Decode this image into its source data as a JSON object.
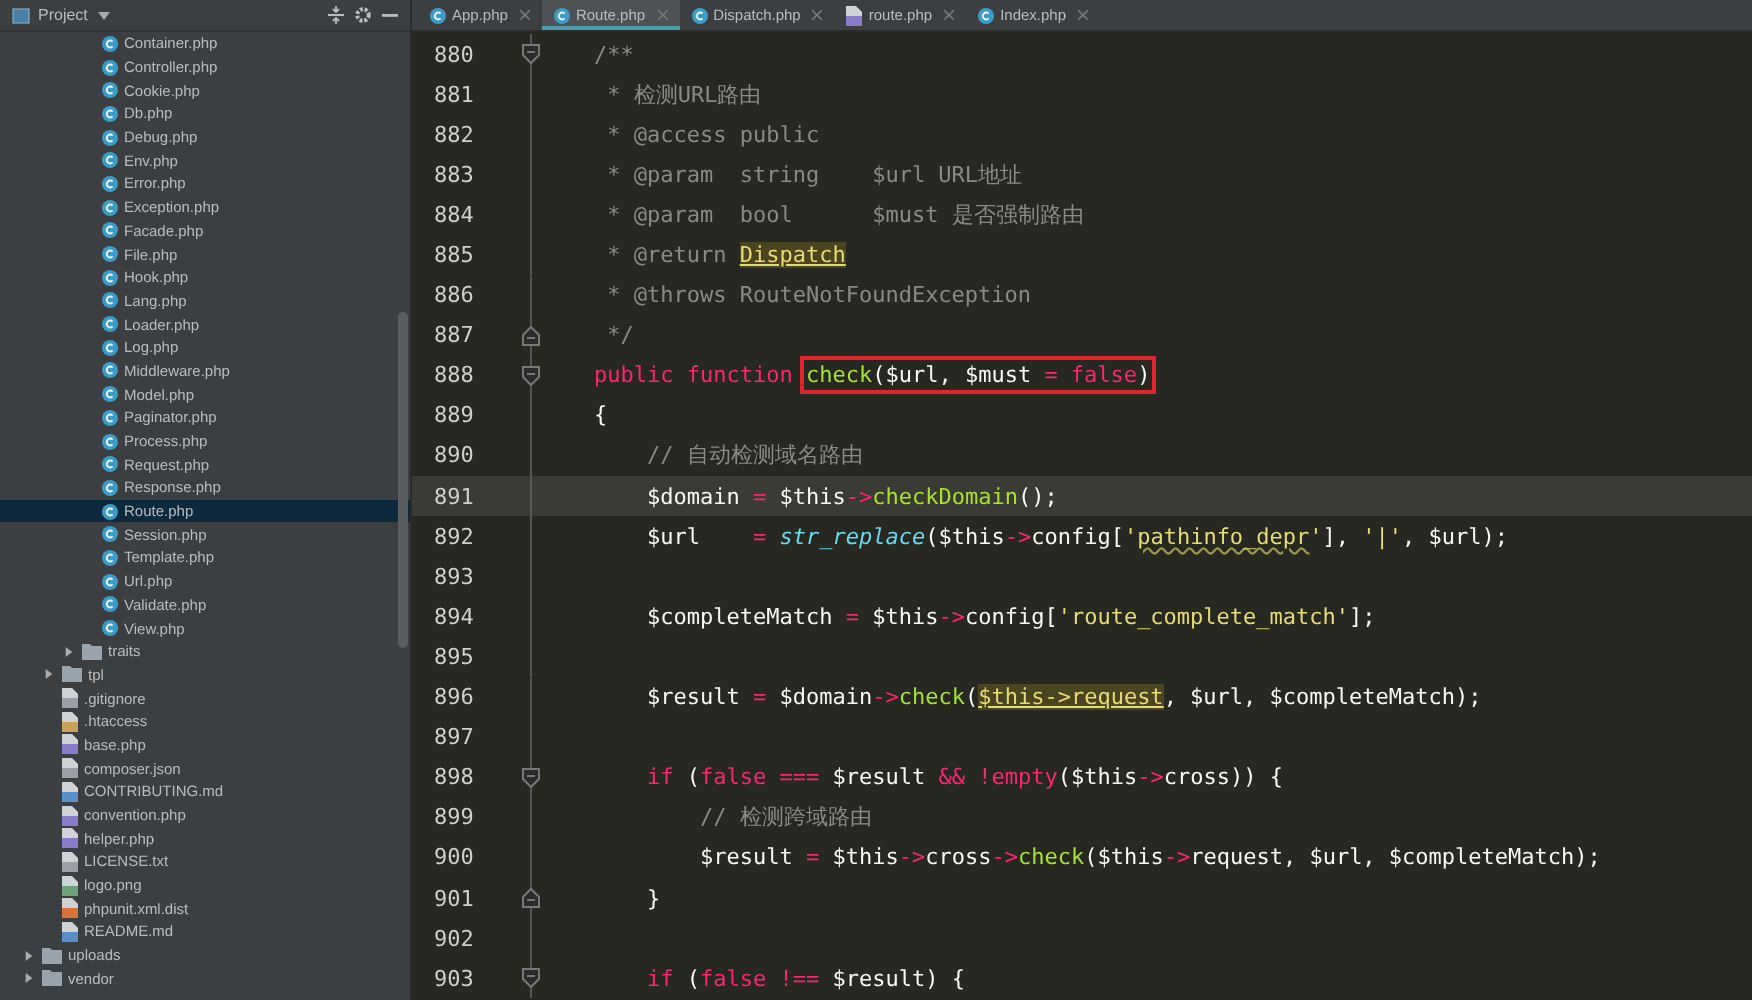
{
  "sidebar": {
    "title": "Project",
    "tree": [
      {
        "children": [
          {
            "children": [
              {
                "children": [
                  {
                    "label": "Container.php",
                    "kind": "class",
                    "selected": false
                  },
                  {
                    "label": "Controller.php",
                    "kind": "class",
                    "selected": false
                  },
                  {
                    "label": "Cookie.php",
                    "kind": "class",
                    "selected": false
                  },
                  {
                    "label": "Db.php",
                    "kind": "class",
                    "selected": false
                  },
                  {
                    "label": "Debug.php",
                    "kind": "class",
                    "selected": false
                  },
                  {
                    "label": "Env.php",
                    "kind": "class",
                    "selected": false
                  },
                  {
                    "label": "Error.php",
                    "kind": "class",
                    "selected": false
                  },
                  {
                    "label": "Exception.php",
                    "kind": "class",
                    "selected": false
                  },
                  {
                    "label": "Facade.php",
                    "kind": "class",
                    "selected": false
                  },
                  {
                    "label": "File.php",
                    "kind": "class",
                    "selected": false
                  },
                  {
                    "label": "Hook.php",
                    "kind": "class",
                    "selected": false
                  },
                  {
                    "label": "Lang.php",
                    "kind": "class",
                    "selected": false
                  },
                  {
                    "label": "Loader.php",
                    "kind": "class",
                    "selected": false
                  },
                  {
                    "label": "Log.php",
                    "kind": "class",
                    "selected": false
                  },
                  {
                    "label": "Middleware.php",
                    "kind": "class",
                    "selected": false
                  },
                  {
                    "label": "Model.php",
                    "kind": "class",
                    "selected": false
                  },
                  {
                    "label": "Paginator.php",
                    "kind": "class",
                    "selected": false
                  },
                  {
                    "label": "Process.php",
                    "kind": "class",
                    "selected": false
                  },
                  {
                    "label": "Request.php",
                    "kind": "class",
                    "selected": false
                  },
                  {
                    "label": "Response.php",
                    "kind": "class",
                    "selected": false
                  },
                  {
                    "label": "Route.php",
                    "kind": "class",
                    "selected": true
                  },
                  {
                    "label": "Session.php",
                    "kind": "class",
                    "selected": false
                  },
                  {
                    "label": "Template.php",
                    "kind": "class",
                    "selected": false
                  },
                  {
                    "label": "Url.php",
                    "kind": "class",
                    "selected": false
                  },
                  {
                    "label": "Validate.php",
                    "kind": "class",
                    "selected": false
                  },
                  {
                    "label": "View.php",
                    "kind": "class",
                    "selected": false
                  }
                ]
              },
              {
                "label": "traits",
                "kind": "folder",
                "expanded": false,
                "selected": false
              }
            ]
          },
          {
            "label": "tpl",
            "kind": "folder",
            "expanded": false,
            "selected": false
          },
          {
            "label": ".gitignore",
            "kind": "text",
            "selected": false
          },
          {
            "label": ".htaccess",
            "kind": "config",
            "selected": false
          },
          {
            "label": "base.php",
            "kind": "php",
            "selected": false
          },
          {
            "label": "composer.json",
            "kind": "text",
            "selected": false
          },
          {
            "label": "CONTRIBUTING.md",
            "kind": "markdown",
            "selected": false
          },
          {
            "label": "convention.php",
            "kind": "php",
            "selected": false
          },
          {
            "label": "helper.php",
            "kind": "php",
            "selected": false
          },
          {
            "label": "LICENSE.txt",
            "kind": "text",
            "selected": false
          },
          {
            "label": "logo.png",
            "kind": "image",
            "selected": false
          },
          {
            "label": "phpunit.xml.dist",
            "kind": "xml",
            "selected": false
          },
          {
            "label": "README.md",
            "kind": "markdown",
            "selected": false
          }
        ]
      },
      {
        "label": "uploads",
        "kind": "folder",
        "expanded": false,
        "selected": false
      },
      {
        "label": "vendor",
        "kind": "folder",
        "expanded": false,
        "selected": false
      }
    ]
  },
  "tabs": [
    {
      "label": "App.php",
      "kind": "class",
      "selected": false
    },
    {
      "label": "Route.php",
      "kind": "class",
      "selected": true
    },
    {
      "label": "Dispatch.php",
      "kind": "class",
      "selected": false
    },
    {
      "label": "route.php",
      "kind": "php",
      "selected": false
    },
    {
      "label": "Index.php",
      "kind": "class",
      "selected": false
    }
  ],
  "editor": {
    "lines": [
      {
        "number": "880",
        "kind": "fold-start",
        "current": false,
        "tokens": [
          {
            "text": "/**",
            "kind": "comment"
          }
        ]
      },
      {
        "number": "881",
        "kind": "plain",
        "current": false,
        "tokens": [
          {
            "text": " * 检测URL路由",
            "kind": "comment"
          }
        ]
      },
      {
        "number": "882",
        "kind": "plain",
        "current": false,
        "tokens": [
          {
            "text": " * @access public",
            "kind": "comment"
          }
        ]
      },
      {
        "number": "883",
        "kind": "plain",
        "current": false,
        "tokens": [
          {
            "text": " * @param  string    $url URL地址",
            "kind": "comment"
          }
        ]
      },
      {
        "number": "884",
        "kind": "plain",
        "current": false,
        "tokens": [
          {
            "text": " * @param  bool      $must 是否强制路由",
            "kind": "comment"
          }
        ]
      },
      {
        "number": "885",
        "kind": "plain",
        "current": false,
        "tokens": [
          {
            "text": " * @return ",
            "kind": "comment"
          },
          {
            "text": "Dispatch",
            "kind": "ref"
          }
        ]
      },
      {
        "number": "886",
        "kind": "plain",
        "current": false,
        "tokens": [
          {
            "text": " * @throws RouteNotFoundException",
            "kind": "comment"
          }
        ]
      },
      {
        "number": "887",
        "kind": "fold-end",
        "current": false,
        "tokens": [
          {
            "text": " */",
            "kind": "comment"
          }
        ]
      },
      {
        "number": "888",
        "kind": "fold-start",
        "current": false,
        "tokens": [
          {
            "text": "public function ",
            "kind": "keyword"
          },
          {
            "kind": "box",
            "tokens": [
              {
                "text": "check",
                "kind": "function"
              },
              {
                "text": "($url, $must ",
                "kind": "plain"
              },
              {
                "text": "=",
                "kind": "operator"
              },
              {
                "text": " false",
                "kind": "keyword"
              },
              {
                "text": ")",
                "kind": "plain"
              }
            ]
          }
        ]
      },
      {
        "number": "889",
        "kind": "plain",
        "current": false,
        "tokens": [
          {
            "text": "{",
            "kind": "plain"
          }
        ]
      },
      {
        "number": "890",
        "kind": "plain",
        "current": false,
        "tokens": [
          {
            "text": "    // 自动检测域名路由",
            "kind": "comment"
          }
        ]
      },
      {
        "number": "891",
        "kind": "plain",
        "current": true,
        "tokens": [
          {
            "text": "    $domain ",
            "kind": "plain"
          },
          {
            "text": "=",
            "kind": "operator"
          },
          {
            "text": " $this",
            "kind": "plain"
          },
          {
            "text": "->",
            "kind": "operator"
          },
          {
            "text": "checkDomain",
            "kind": "function"
          },
          {
            "text": "();",
            "kind": "plain"
          }
        ]
      },
      {
        "number": "892",
        "kind": "plain",
        "current": false,
        "tokens": [
          {
            "text": "    $url    ",
            "kind": "plain"
          },
          {
            "text": "= ",
            "kind": "operator"
          },
          {
            "text": "str_replace",
            "kind": "builtin"
          },
          {
            "text": "($this",
            "kind": "plain"
          },
          {
            "text": "->",
            "kind": "operator"
          },
          {
            "text": "config[",
            "kind": "plain"
          },
          {
            "text": "'",
            "kind": "string"
          },
          {
            "text": "pathinfo_depr",
            "kind": "typo"
          },
          {
            "text": "'",
            "kind": "string"
          },
          {
            "text": "], ",
            "kind": "plain"
          },
          {
            "text": "'|'",
            "kind": "string"
          },
          {
            "text": ", $url);",
            "kind": "plain"
          }
        ]
      },
      {
        "number": "893",
        "kind": "plain",
        "current": false
      },
      {
        "number": "894",
        "kind": "plain",
        "current": false,
        "tokens": [
          {
            "text": "    $completeMatch ",
            "kind": "plain"
          },
          {
            "text": "=",
            "kind": "operator"
          },
          {
            "text": " $this",
            "kind": "plain"
          },
          {
            "text": "->",
            "kind": "operator"
          },
          {
            "text": "config[",
            "kind": "plain"
          },
          {
            "text": "'route_complete_match'",
            "kind": "string"
          },
          {
            "text": "];",
            "kind": "plain"
          }
        ]
      },
      {
        "number": "895",
        "kind": "plain",
        "current": false
      },
      {
        "number": "896",
        "kind": "plain",
        "current": false,
        "tokens": [
          {
            "text": "    $result ",
            "kind": "plain"
          },
          {
            "text": "=",
            "kind": "operator"
          },
          {
            "text": " $domain",
            "kind": "plain"
          },
          {
            "text": "->",
            "kind": "operator"
          },
          {
            "text": "check",
            "kind": "function"
          },
          {
            "text": "(",
            "kind": "plain"
          },
          {
            "text": "$this->request",
            "kind": "ref"
          },
          {
            "text": ", $url, $completeMatch);",
            "kind": "plain"
          }
        ]
      },
      {
        "number": "897",
        "kind": "plain",
        "current": false
      },
      {
        "number": "898",
        "kind": "fold-start",
        "current": false,
        "tokens": [
          {
            "text": "    if",
            "kind": "keyword"
          },
          {
            "text": " (",
            "kind": "plain"
          },
          {
            "text": "false ",
            "kind": "keyword"
          },
          {
            "text": "===",
            "kind": "operator"
          },
          {
            "text": " $result ",
            "kind": "plain"
          },
          {
            "text": "&& ",
            "kind": "operator"
          },
          {
            "text": "!empty",
            "kind": "keyword"
          },
          {
            "text": "($this",
            "kind": "plain"
          },
          {
            "text": "->",
            "kind": "operator"
          },
          {
            "text": "cross)) {",
            "kind": "plain"
          }
        ]
      },
      {
        "number": "899",
        "kind": "plain",
        "current": false,
        "tokens": [
          {
            "text": "        // 检测跨域路由",
            "kind": "comment"
          }
        ]
      },
      {
        "number": "900",
        "kind": "plain",
        "current": false,
        "tokens": [
          {
            "text": "        $result ",
            "kind": "plain"
          },
          {
            "text": "=",
            "kind": "operator"
          },
          {
            "text": " $this",
            "kind": "plain"
          },
          {
            "text": "->",
            "kind": "operator"
          },
          {
            "text": "cross",
            "kind": "plain"
          },
          {
            "text": "->",
            "kind": "operator"
          },
          {
            "text": "check",
            "kind": "function"
          },
          {
            "text": "($this",
            "kind": "plain"
          },
          {
            "text": "->",
            "kind": "operator"
          },
          {
            "text": "request, $url, $completeMatch);",
            "kind": "plain"
          }
        ]
      },
      {
        "number": "901",
        "kind": "fold-end",
        "current": false,
        "tokens": [
          {
            "text": "    }",
            "kind": "plain"
          }
        ]
      },
      {
        "number": "902",
        "kind": "plain",
        "current": false
      },
      {
        "number": "903",
        "kind": "fold-start",
        "current": false,
        "tokens": [
          {
            "text": "    if",
            "kind": "keyword"
          },
          {
            "text": " (",
            "kind": "plain"
          },
          {
            "text": "false ",
            "kind": "keyword"
          },
          {
            "text": "!==",
            "kind": "operator"
          },
          {
            "text": " $result) {",
            "kind": "plain"
          }
        ]
      }
    ]
  }
}
